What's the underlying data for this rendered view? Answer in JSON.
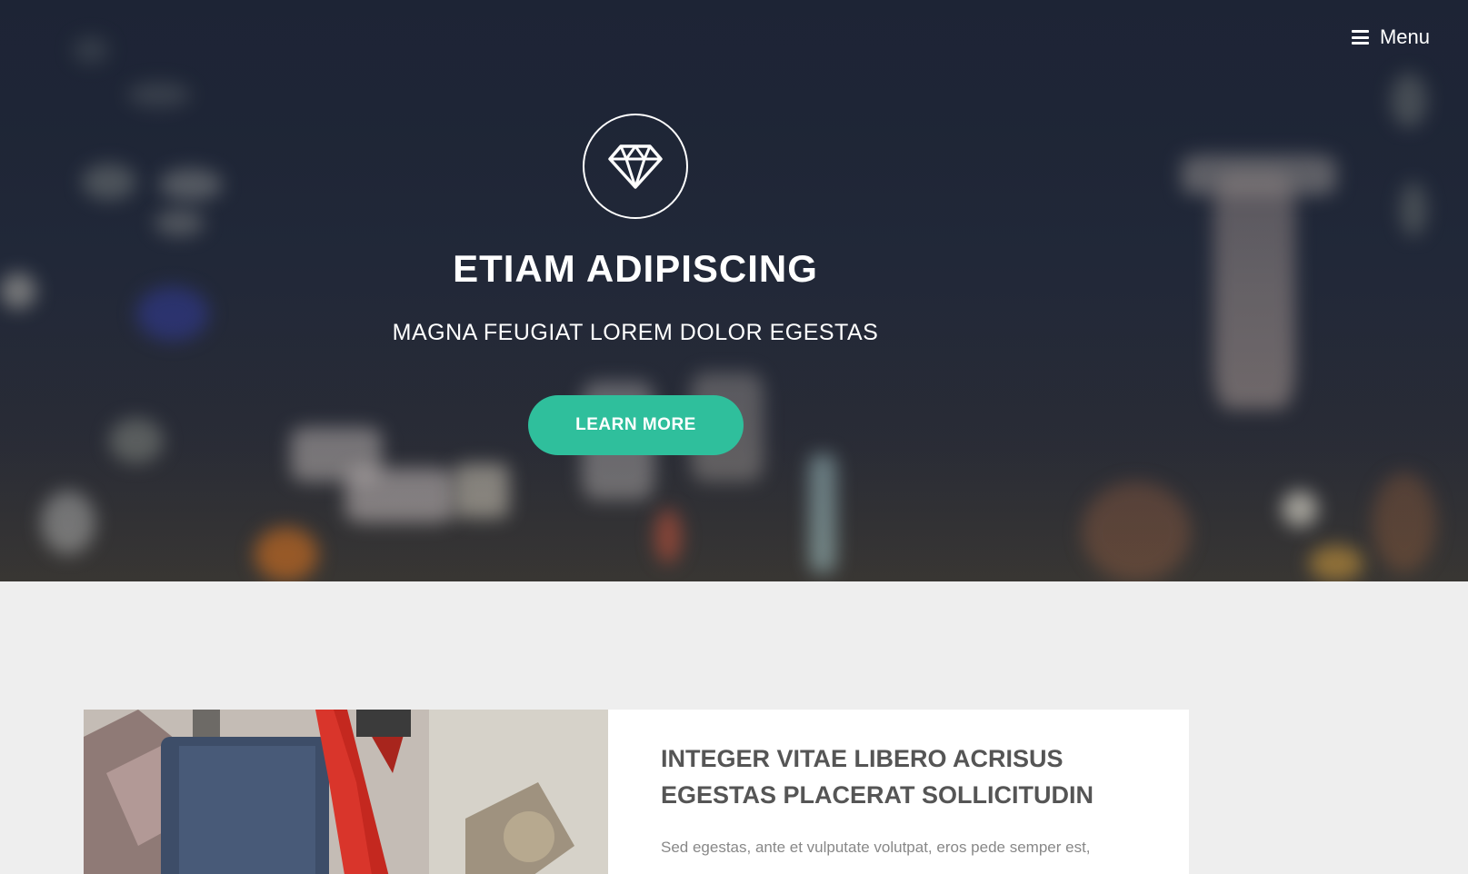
{
  "menu": {
    "icon": "hamburger-icon",
    "label": "Menu"
  },
  "hero": {
    "icon": "diamond-icon",
    "title": "ETIAM ADIPISCING",
    "subtitle": "MAGNA FEUGIAT LOREM DOLOR EGESTAS",
    "button_label": "LEARN MORE",
    "accent_color": "#2fbf9c"
  },
  "feature": {
    "title": "INTEGER VITAE LIBERO ACRISUS EGESTAS PLACERAT SOLLICITUDIN",
    "text": "Sed egestas, ante et vulputate volutpat, eros pede semper est,"
  }
}
